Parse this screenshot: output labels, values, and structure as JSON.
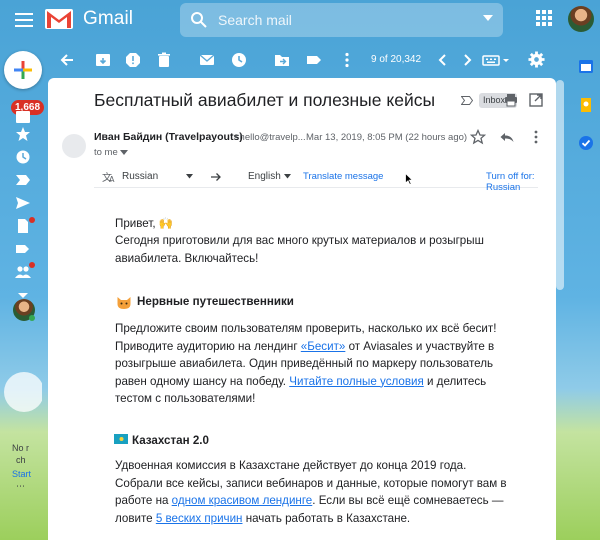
{
  "app": {
    "name": "Gmail",
    "search_placeholder": "Search mail",
    "pager": "9 of 20,342",
    "inbox_badge": "1,668"
  },
  "colors": {
    "gmail_red": "#ea4335",
    "link_blue": "#1a73e8",
    "badge_red": "#d93025"
  },
  "toolbar": {
    "icons": [
      "back-icon",
      "archive-icon",
      "report-spam-icon",
      "delete-icon",
      "mark-unread-icon",
      "snooze-icon",
      "move-to-icon",
      "labels-icon",
      "more-icon",
      "newer-icon",
      "older-icon",
      "input-tools-icon",
      "settings-icon"
    ]
  },
  "rail": {
    "icons": [
      "inbox-icon",
      "starred-icon",
      "snoozed-icon",
      "important-icon",
      "sent-icon",
      "drafts-icon",
      "label-icon",
      "contacts-icon",
      "more-icon"
    ],
    "hangouts_text_1": "No r",
    "hangouts_text_2": "ch",
    "hangouts_link": "Start",
    "hangouts_dots": "⋯"
  },
  "message": {
    "subject": "Бесплатный авиабилет и полезные кейсы",
    "label": "Inbox",
    "sender_name": "Иван Байдин (Travelpayouts)",
    "sender_email": "<hello@travelp...",
    "date": "Mar 13, 2019, 8:05 PM (22 hours ago)",
    "to": "to me",
    "translate": {
      "from": "Russian",
      "to": "English",
      "action": "Translate message",
      "turn_off": "Turn off for: Russian",
      "close": "×"
    },
    "greeting": "Привет, 🙌",
    "intro": "Сегодня приготовили для вас много крутых материалов и розыгрыш авиабилета. Включайтесь!",
    "section1": {
      "title": "Нервные путешественники",
      "p1": "Предложите своим пользователям проверить, насколько их всё бесит! Приводите аудиторию на лендинг ",
      "link1": "«Бесит»",
      "p2": " от Aviasales и участвуйте в розыгрыше авиабилета. Один приведённый по маркеру пользователь равен одному шансу на победу. ",
      "link2": "Читайте полные условия",
      "p3": " и делитесь тестом с пользователями!"
    },
    "section2": {
      "title": "Казахстан 2.0",
      "p1": "Удвоенная комиссия в Казахстане действует до конца 2019 года. Собрали все кейсы, записи вебинаров и данные, которые помогут вам в работе на ",
      "link1": "одном красивом лендинге",
      "p2": ". Если вы всё ещё сомневаетесь — ловите ",
      "link2": "5 веских причин",
      "p3": " начать работать в Казахстане."
    }
  }
}
